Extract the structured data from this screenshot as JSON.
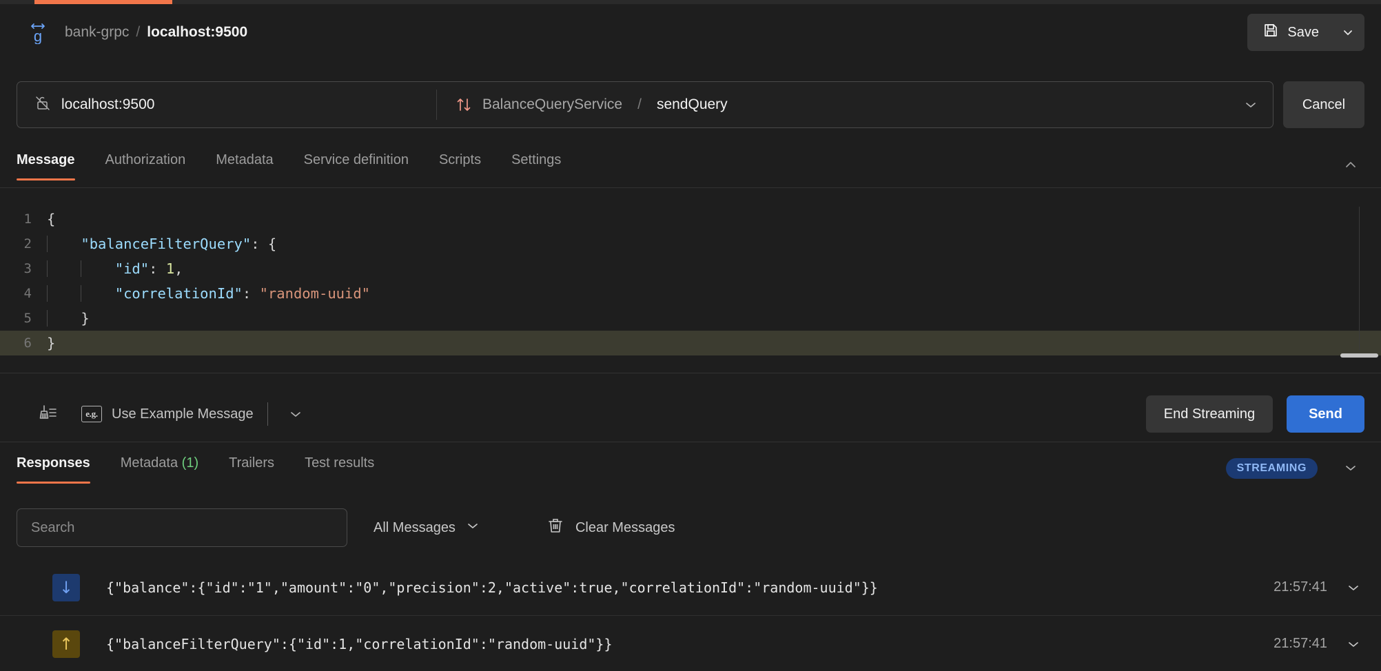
{
  "window": {
    "progress_accent": "#f2764a",
    "background": "#1e1e1e"
  },
  "header": {
    "logo_icon": "grpc-logo-icon",
    "breadcrumb_parent": "bank-grpc",
    "breadcrumb_separator": "/",
    "breadcrumb_current": "localhost:9500",
    "save_label": "Save",
    "save_icon": "floppy-disk-icon",
    "save_caret_icon": "chevron-down-icon"
  },
  "urlbar": {
    "lock_icon": "unlocked-strikethrough-icon",
    "host": "localhost:9500",
    "stream_icon": "bidirectional-stream-arrows-icon",
    "service": "BalanceQueryService",
    "separator": "/",
    "method": "sendQuery",
    "dropdown_icon": "chevron-down-icon",
    "cancel_label": "Cancel"
  },
  "request_tabs": {
    "items": [
      {
        "label": "Message",
        "active": true
      },
      {
        "label": "Authorization",
        "active": false
      },
      {
        "label": "Metadata",
        "active": false
      },
      {
        "label": "Service definition",
        "active": false
      },
      {
        "label": "Scripts",
        "active": false
      },
      {
        "label": "Settings",
        "active": false
      }
    ],
    "collapse_icon": "chevron-up-icon"
  },
  "editor": {
    "language": "json",
    "active_line": 6,
    "lines": [
      {
        "num": "1",
        "tokens": [
          {
            "t": "{",
            "c": "punct"
          }
        ],
        "indent_guides": 0
      },
      {
        "num": "2",
        "tokens": [
          {
            "t": "    ",
            "c": "punct"
          },
          {
            "t": "\"balanceFilterQuery\"",
            "c": "key"
          },
          {
            "t": ": {",
            "c": "punct"
          }
        ],
        "indent_guides": 1
      },
      {
        "num": "3",
        "tokens": [
          {
            "t": "        ",
            "c": "punct"
          },
          {
            "t": "\"id\"",
            "c": "key"
          },
          {
            "t": ": ",
            "c": "punct"
          },
          {
            "t": "1",
            "c": "num"
          },
          {
            "t": ",",
            "c": "punct"
          }
        ],
        "indent_guides": 2
      },
      {
        "num": "4",
        "tokens": [
          {
            "t": "        ",
            "c": "punct"
          },
          {
            "t": "\"correlationId\"",
            "c": "key"
          },
          {
            "t": ": ",
            "c": "punct"
          },
          {
            "t": "\"random-uuid\"",
            "c": "str"
          }
        ],
        "indent_guides": 2
      },
      {
        "num": "5",
        "tokens": [
          {
            "t": "    }",
            "c": "punct"
          }
        ],
        "indent_guides": 1
      },
      {
        "num": "6",
        "tokens": [
          {
            "t": "}",
            "c": "punct"
          }
        ],
        "indent_guides": 0
      }
    ]
  },
  "message_bar": {
    "beautify_icon": "broom-icon",
    "example_icon": "eg-box-icon",
    "example_label": "Use Example Message",
    "example_caret_icon": "chevron-down-icon",
    "end_streaming_label": "End Streaming",
    "send_label": "Send",
    "send_color": "#2f6fd4"
  },
  "response_tabs": {
    "items": [
      {
        "label": "Responses",
        "count": "",
        "active": true
      },
      {
        "label": "Metadata",
        "count": "(1)",
        "active": false
      },
      {
        "label": "Trailers",
        "count": "",
        "active": false
      },
      {
        "label": "Test results",
        "count": "",
        "active": false
      }
    ],
    "status_badge": "STREAMING",
    "status_badge_bg": "#1b3a73",
    "status_badge_color": "#8fb8f5",
    "caret_icon": "chevron-down-icon"
  },
  "filter_row": {
    "search_placeholder": "Search",
    "search_value": "",
    "search_icon": "search-input",
    "filter_label": "All Messages",
    "filter_caret_icon": "chevron-down-icon",
    "clear_icon": "trash-icon",
    "clear_label": "Clear Messages"
  },
  "messages": [
    {
      "direction": "in",
      "direction_icon": "arrow-down-icon",
      "arrow": "↓",
      "body": "{\"balance\":{\"id\":\"1\",\"amount\":\"0\",\"precision\":2,\"active\":true,\"correlationId\":\"random-uuid\"}}",
      "time": "21:57:41",
      "caret_icon": "chevron-down-icon"
    },
    {
      "direction": "out",
      "direction_icon": "arrow-up-icon",
      "arrow": "↑",
      "body": "{\"balanceFilterQuery\":{\"id\":1,\"correlationId\":\"random-uuid\"}}",
      "time": "21:57:41",
      "caret_icon": "chevron-down-icon"
    }
  ]
}
